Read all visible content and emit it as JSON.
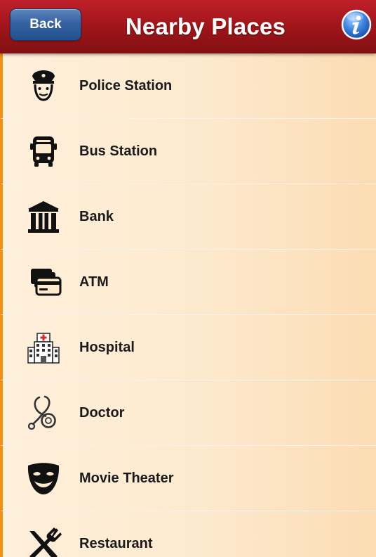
{
  "header": {
    "title": "Nearby Places",
    "back_label": "Back",
    "info_icon": "info-icon"
  },
  "colors": {
    "header_red": "#9e1519",
    "back_button_blue": "#3662a1",
    "info_blue": "#2f6fd4",
    "row_background": "#fde9cd",
    "row_accent_orange": "#ee9216"
  },
  "places": [
    {
      "label": "Police Station",
      "icon": "police-officer-icon"
    },
    {
      "label": "Bus Station",
      "icon": "bus-icon"
    },
    {
      "label": "Bank",
      "icon": "bank-icon"
    },
    {
      "label": "ATM",
      "icon": "atm-card-icon"
    },
    {
      "label": "Hospital",
      "icon": "hospital-icon"
    },
    {
      "label": "Doctor",
      "icon": "stethoscope-icon"
    },
    {
      "label": "Movie Theater",
      "icon": "theater-mask-icon"
    },
    {
      "label": "Restaurant",
      "icon": "fork-knife-icon"
    }
  ]
}
